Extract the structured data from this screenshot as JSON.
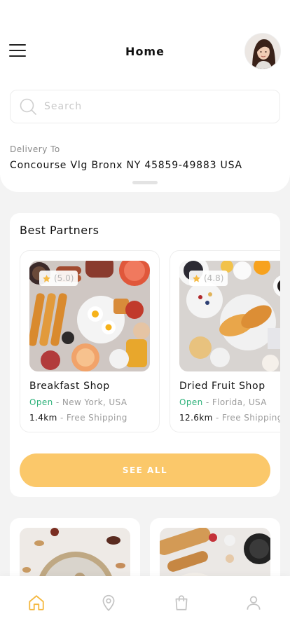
{
  "header": {
    "title": "Home",
    "menu_icon": "hamburger-menu-icon",
    "avatar_icon": "user-avatar"
  },
  "search": {
    "placeholder": "Search",
    "icon": "search-icon"
  },
  "delivery": {
    "label": "Delivery To",
    "address": "Concourse Vlg Bronx NY 45859-49883 USA"
  },
  "partners": {
    "title": "Best Partners",
    "see_all_label": "SEE ALL",
    "shops": [
      {
        "name": "Breakfast Shop",
        "rating": "(5.0)",
        "status": "Open",
        "location": "New York, USA",
        "distance": "1.4km",
        "shipping": "Free Shipping"
      },
      {
        "name": "Dried Fruit Shop",
        "rating": "(4.8)",
        "status": "Open",
        "location": "Florida, USA",
        "distance": "12.6km",
        "shipping": "Free Shipping"
      }
    ]
  },
  "bottom_nav": {
    "items": [
      "home-icon",
      "location-pin-icon",
      "shopping-bag-icon",
      "profile-icon"
    ],
    "active_color": "#f5b942",
    "inactive_color": "#c4c4c4"
  },
  "colors": {
    "accent": "#fbc86a",
    "open_status": "#2fb27b",
    "star": "#f5b942"
  }
}
